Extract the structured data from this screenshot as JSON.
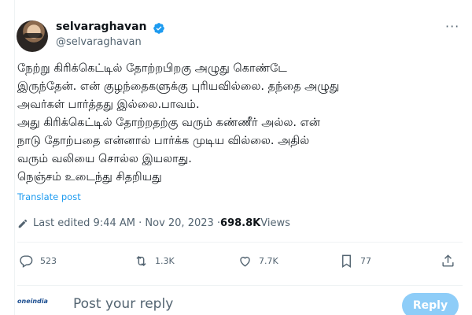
{
  "author": {
    "name": "selvaraghavan",
    "handle": "@selvaraghavan"
  },
  "icons": {
    "more": "more-options-icon",
    "verified": "verified-badge-icon",
    "edit": "pencil-icon",
    "reply": "reply-icon",
    "retweet": "retweet-icon",
    "like": "heart-icon",
    "bookmark": "bookmark-icon",
    "share": "share-icon"
  },
  "tweet": {
    "lines": [
      "நேற்று கிரிக்கெட்டில் தோற்றபிறகு  அழுது கொண்டே",
      "இருந்தேன். என் குழந்தைகளுக்கு புரியவில்லை. தந்தை அழுது",
      "அவர்கள் பார்த்தது இல்லை.பாவம்.",
      "அது கிரிக்கெட்டில் தோற்றதற்கு வரும் கண்ணீர் அல்ல. என்",
      "நாடு தோற்பதை என்னால் பார்க்க முடிய வில்லை. அதில்",
      "வரும் வலியை சொல்ல இயலாது.",
      "நெஞ்சம் உடைந்து சிதறியது"
    ],
    "translate_label": "Translate post"
  },
  "meta": {
    "edited_label": "Last edited 9:44 AM · Nov 20, 2023 · ",
    "views_count": "698.8K",
    "views_label": " Views"
  },
  "actions": {
    "replies": "523",
    "reposts": "1.3K",
    "likes": "7.7K",
    "bookmarks": "77"
  },
  "reply_bar": {
    "brand": "oneindia",
    "placeholder": "Post your reply",
    "button_label": "Reply"
  },
  "colors": {
    "accent": "#1d9bf0",
    "reply_button": "#8ecdf8",
    "secondary_text": "#536471"
  }
}
